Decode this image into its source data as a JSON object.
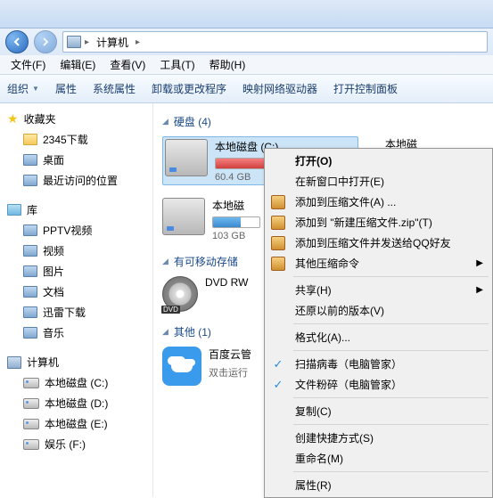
{
  "address": {
    "root": "计算机"
  },
  "menu": {
    "file": "文件(F)",
    "edit": "编辑(E)",
    "view": "查看(V)",
    "tools": "工具(T)",
    "help": "帮助(H)"
  },
  "toolbar": {
    "organize": "组织",
    "properties": "属性",
    "sysProps": "系统属性",
    "uninstall": "卸载或更改程序",
    "mapDrive": "映射网络驱动器",
    "controlPanel": "打开控制面板"
  },
  "sidebar": {
    "favorites": "收藏夹",
    "favItems": [
      "2345下载",
      "桌面",
      "最近访问的位置"
    ],
    "libraries": "库",
    "libItems": [
      "PPTV视频",
      "视频",
      "图片",
      "文档",
      "迅雷下载",
      "音乐"
    ],
    "computer": "计算机",
    "compItems": [
      "本地磁盘 (C:)",
      "本地磁盘 (D:)",
      "本地磁盘 (E:)",
      "娱乐 (F:)"
    ]
  },
  "sections": {
    "hdd": "硬盘 (4)",
    "removable": "有可移动存储",
    "other": "其他 (1)"
  },
  "drives": {
    "c": {
      "name": "本地磁盘 (C:)",
      "free": "60.4 GB"
    },
    "partial": {
      "name": "本地磁"
    },
    "d": {
      "name": "本地磁",
      "free": "103 GB"
    },
    "dvd": {
      "name": "DVD RW"
    },
    "cloud": {
      "name": "百度云管",
      "sub": "双击运行"
    }
  },
  "context": {
    "open": "打开(O)",
    "newWindow": "在新窗口中打开(E)",
    "addArchive": "添加到压缩文件(A) ...",
    "addZip": "添加到 \"新建压缩文件.zip\"(T)",
    "zipQQ": "添加到压缩文件并发送给QQ好友",
    "otherZip": "其他压缩命令",
    "share": "共享(H)",
    "restore": "还原以前的版本(V)",
    "format": "格式化(A)...",
    "scan": "扫描病毒（电脑管家）",
    "shred": "文件粉碎（电脑管家）",
    "copy": "复制(C)",
    "shortcut": "创建快捷方式(S)",
    "rename": "重命名(M)",
    "props": "属性(R)"
  }
}
